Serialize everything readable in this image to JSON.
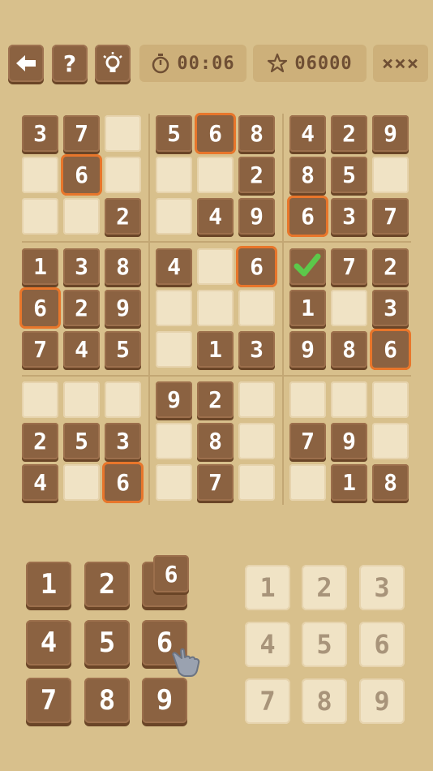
{
  "header": {
    "back_icon": "arrow-left-icon",
    "help_label": "?",
    "hint_icon": "lightbulb-icon",
    "timer": "00:06",
    "score": "06000",
    "lives": "×××"
  },
  "board": [
    [
      "3",
      "7",
      "",
      "5",
      "6",
      "8",
      "4",
      "2",
      "9"
    ],
    [
      "",
      "6",
      "",
      "",
      "",
      "2",
      "8",
      "5",
      ""
    ],
    [
      "",
      "",
      "2",
      "",
      "4",
      "9",
      "6",
      "3",
      "7"
    ],
    [
      "1",
      "3",
      "8",
      "4",
      "",
      "6",
      "",
      "7",
      "2"
    ],
    [
      "6",
      "2",
      "9",
      "",
      "",
      "",
      "1",
      "",
      "3"
    ],
    [
      "7",
      "4",
      "5",
      "",
      "1",
      "3",
      "9",
      "8",
      "6"
    ],
    [
      "",
      "",
      "",
      "9",
      "2",
      "",
      "",
      "",
      ""
    ],
    [
      "2",
      "5",
      "3",
      "",
      "8",
      "",
      "7",
      "9",
      ""
    ],
    [
      "4",
      "",
      "6",
      "",
      "7",
      "",
      "",
      "1",
      "8"
    ]
  ],
  "highlighted": [
    [
      0,
      4
    ],
    [
      1,
      1
    ],
    [
      2,
      6
    ],
    [
      3,
      5
    ],
    [
      4,
      0
    ],
    [
      5,
      8
    ],
    [
      8,
      2
    ]
  ],
  "checked_cell": [
    3,
    6
  ],
  "number_pad": [
    "1",
    "2",
    "",
    "4",
    "5",
    "6",
    "7",
    "8",
    "9"
  ],
  "dragging_value": "6",
  "ghost_pad": [
    "1",
    "2",
    "3",
    "4",
    "5",
    "6",
    "7",
    "8",
    "9"
  ],
  "colors": {
    "background": "#d8c08c",
    "tile": "#8b6241",
    "empty": "#f0e3c5",
    "highlight": "#e8762b",
    "check": "#5cc84a"
  }
}
